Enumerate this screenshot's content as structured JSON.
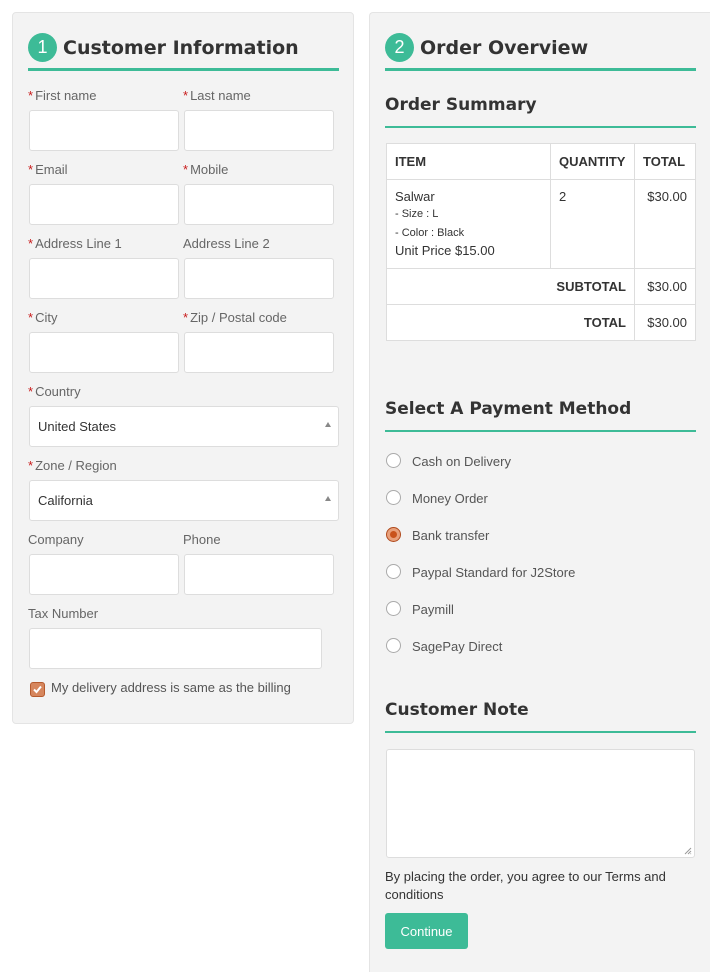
{
  "customer": {
    "step_number": "1",
    "title": "Customer Information",
    "fields": {
      "first_name": "First name",
      "last_name": "Last name",
      "email": "Email",
      "mobile": "Mobile",
      "address1": "Address Line 1",
      "address2": "Address Line 2",
      "city": "City",
      "zip": "Zip / Postal code",
      "country": "Country",
      "zone": "Zone / Region",
      "company": "Company",
      "phone": "Phone",
      "tax": "Tax Number"
    },
    "required_mark": "*",
    "country_value": "United States",
    "zone_value": "California",
    "same_address_label": "My delivery address is same as the billing",
    "same_address_checked": true
  },
  "order": {
    "step_number": "2",
    "title": "Order Overview",
    "summary_title": "Order Summary",
    "columns": {
      "item": "ITEM",
      "quantity": "QUANTITY",
      "total": "TOTAL"
    },
    "item": {
      "name": "Salwar",
      "size": "- Size : L",
      "color": "- Color : Black",
      "unit_price": "Unit Price $15.00",
      "quantity": "2",
      "total": "$30.00"
    },
    "subtotal_label": "SUBTOTAL",
    "subtotal_value": "$30.00",
    "total_label": "TOTAL",
    "total_value": "$30.00",
    "payment_title": "Select A Payment Method",
    "payment_methods": [
      "Cash on Delivery",
      "Money Order",
      "Bank transfer",
      "Paypal Standard for J2Store",
      "Paymill",
      "SagePay Direct"
    ],
    "selected_payment": "Bank transfer",
    "note_title": "Customer Note",
    "terms_text": "By placing the order, you agree to our Terms and conditions",
    "continue_label": "Continue"
  },
  "colors": {
    "accent": "#3dbb97",
    "required": "#c81a1a",
    "radio_selected": "#c9531c"
  }
}
